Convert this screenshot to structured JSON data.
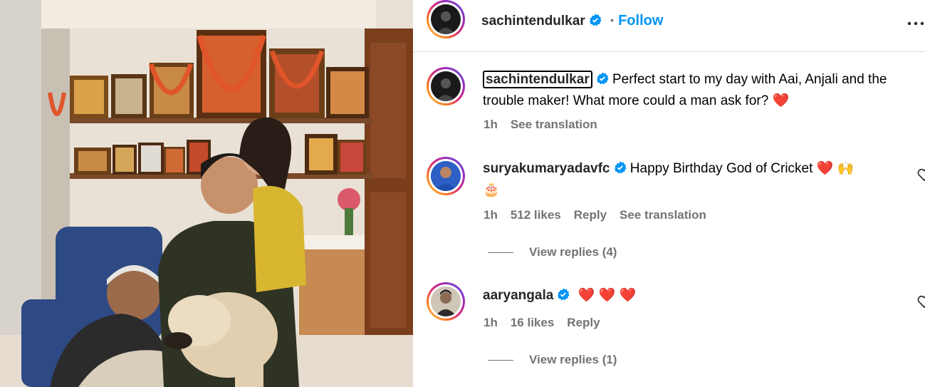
{
  "header": {
    "username": "sachintendulkar",
    "separator": "•",
    "follow_label": "Follow",
    "more_icon": "ellipsis-icon"
  },
  "caption": {
    "username": "sachintendulkar",
    "text": "Perfect start to my day with Aai, Anjali and the trouble maker! What more could a man ask for?",
    "emoji": "❤️",
    "time": "1h",
    "see_translation": "See translation"
  },
  "comments": [
    {
      "username": "suryakumaryadavfc",
      "text": "Happy Birthday God of Cricket",
      "emoji_1": "❤️",
      "emoji_2": "🙌",
      "emoji_3": "🎂",
      "time": "1h",
      "likes": "512 likes",
      "reply": "Reply",
      "see_translation": "See translation",
      "view_replies": "View replies (4)"
    },
    {
      "username": "aaryangala",
      "emoji_1": "❤️",
      "emoji_2": "❤️",
      "emoji_3": "❤️",
      "time": "1h",
      "likes": "16 likes",
      "reply": "Reply",
      "view_replies": "View replies (1)"
    }
  ],
  "colors": {
    "link": "#0095f6",
    "verified": "#0095f6",
    "muted": "#737373",
    "heart": "#ed4956"
  }
}
